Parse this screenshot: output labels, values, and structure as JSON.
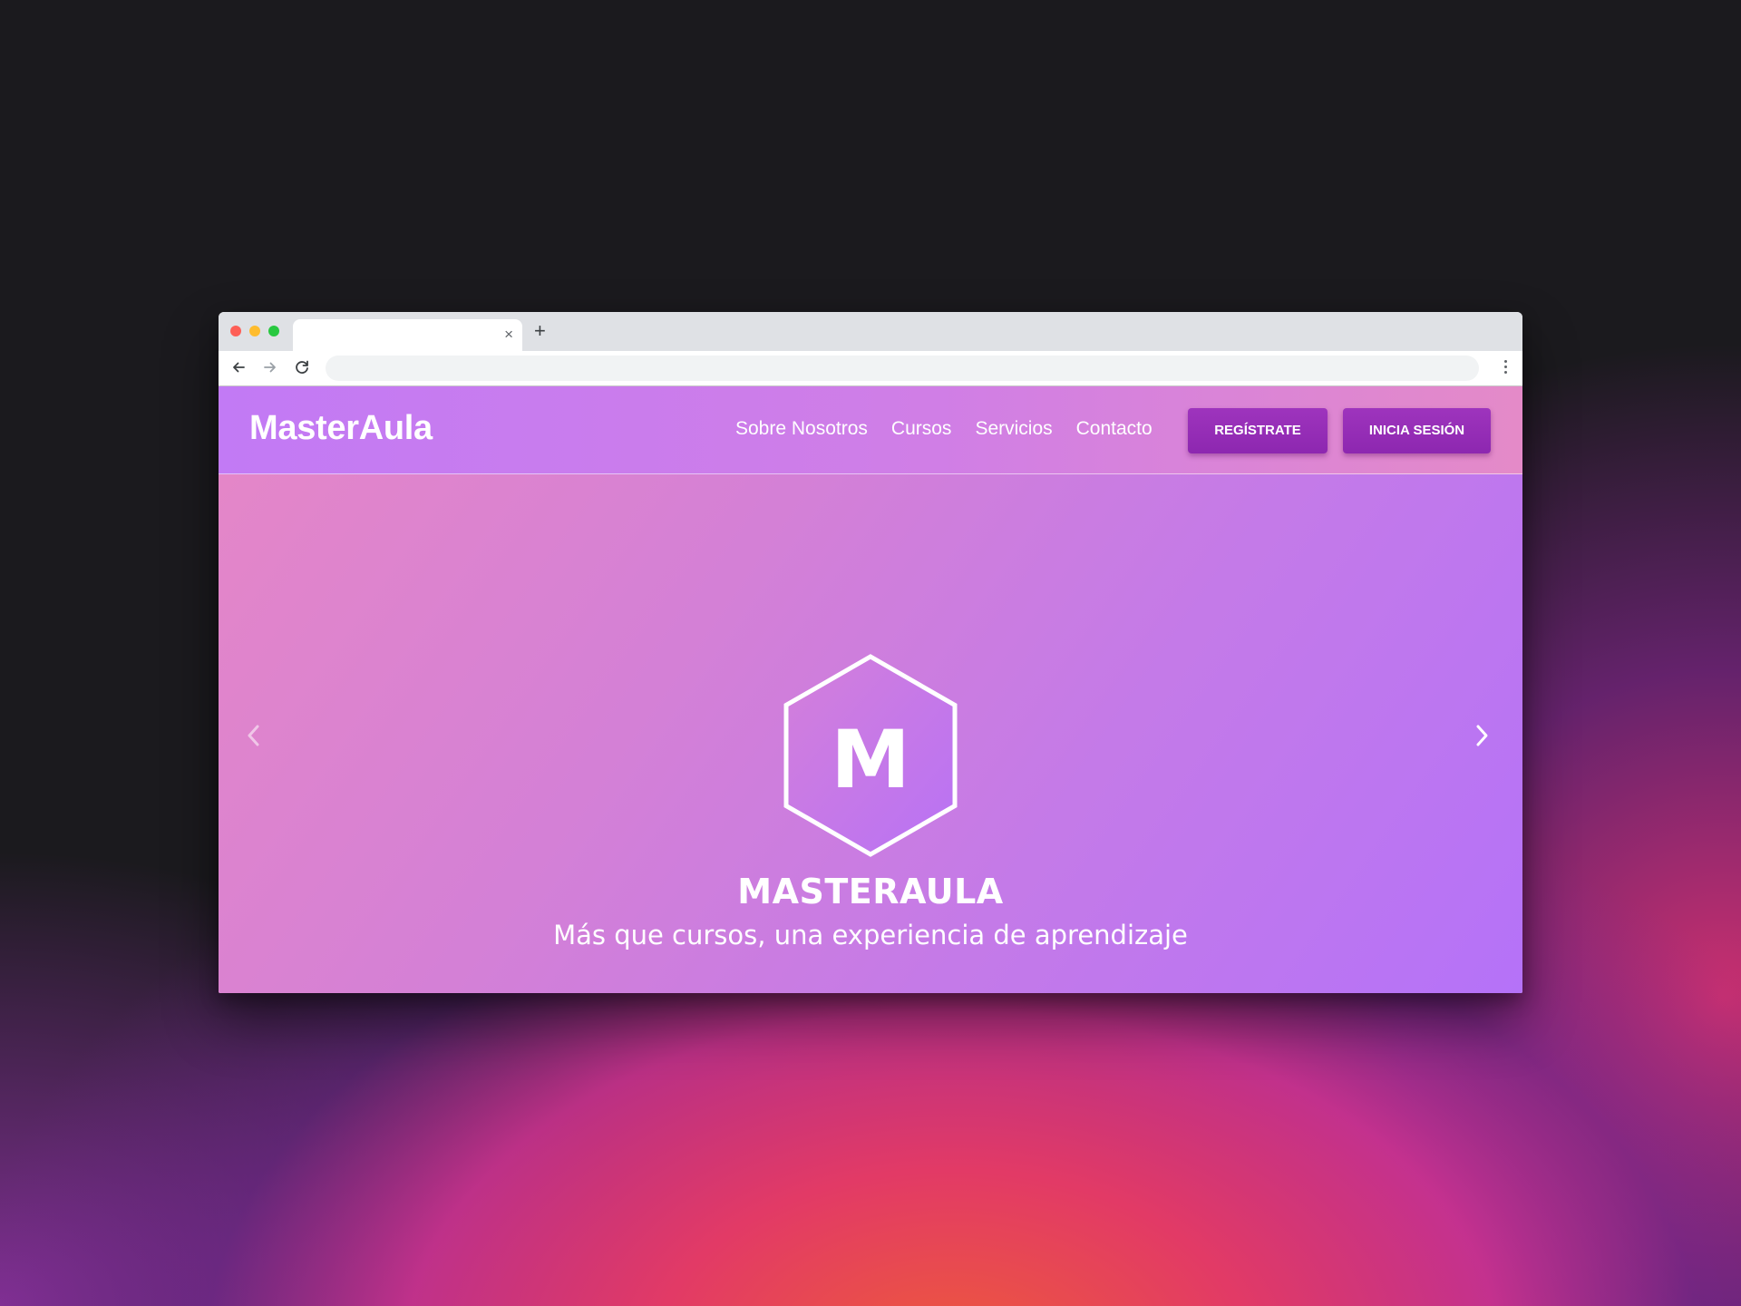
{
  "browser": {
    "tab_close_glyph": "×",
    "new_tab_glyph": "+",
    "address_value": ""
  },
  "header": {
    "logo_text": "MasterAula",
    "nav": [
      {
        "label": "Sobre Nosotros"
      },
      {
        "label": "Cursos"
      },
      {
        "label": "Servicios"
      },
      {
        "label": "Contacto"
      }
    ],
    "register_label": "REGÍSTRATE",
    "login_label": "INICIA SESIÓN"
  },
  "hero": {
    "emblem_letter": "M",
    "title": "MASTERAULA",
    "subtitle": "Más que cursos, una experiencia de aprendizaje",
    "prev_icon": "chevron-left-icon",
    "next_icon": "chevron-right-icon"
  },
  "colors": {
    "button_bg": "#8d27b0",
    "header_gradient_start": "#c27af5",
    "header_gradient_end": "#e48ac8",
    "hero_gradient_start": "#e486c8",
    "hero_gradient_end": "#b572f8"
  }
}
